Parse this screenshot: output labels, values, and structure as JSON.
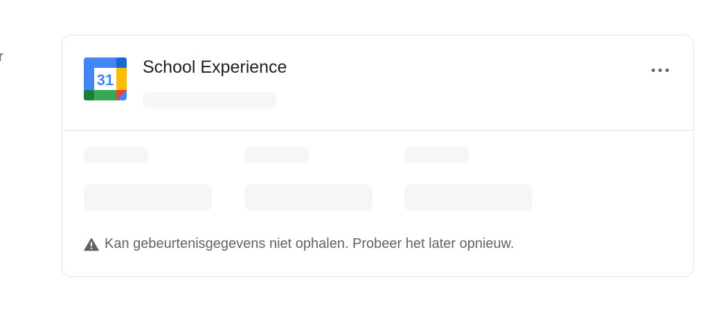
{
  "edge_fragment": "r",
  "card": {
    "title": "School Experience",
    "app_icon": "google-calendar-icon",
    "app_icon_day": "31",
    "more_icon": "more-horizontal-icon",
    "error_icon": "warning-icon",
    "error_message": "Kan gebeurtenisgegevens niet ophalen. Probeer het later opnieuw."
  },
  "colors": {
    "border": "#e3e3e3",
    "skeleton": "#f6f6f6",
    "muted_text": "#5f6368",
    "calendar_blue": "#4285f4",
    "calendar_green": "#34a853",
    "calendar_yellow": "#fbbc04",
    "calendar_red": "#ea4335"
  }
}
